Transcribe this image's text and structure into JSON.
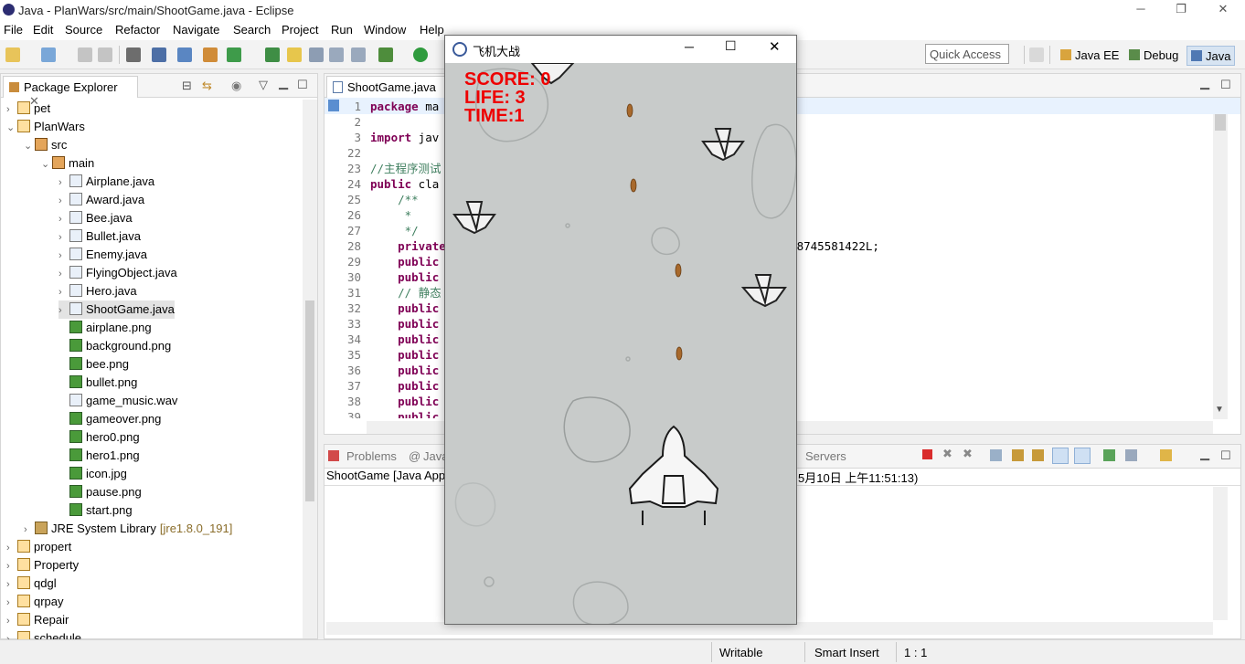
{
  "window": {
    "title": "Java - PlanWars/src/main/ShootGame.java - Eclipse"
  },
  "menu": [
    "File",
    "Edit",
    "Source",
    "Refactor",
    "Navigate",
    "Search",
    "Project",
    "Run",
    "Window",
    "Help"
  ],
  "toolbar": {
    "quick_access_placeholder": "Quick Access"
  },
  "perspectives": [
    "Java EE",
    "Debug",
    "Java"
  ],
  "package_explorer": {
    "title": "Package Explorer",
    "tree": [
      {
        "label": "pet",
        "indent": 0,
        "arrow": ">",
        "icon": "project"
      },
      {
        "label": "PlanWars",
        "indent": 0,
        "arrow": "v",
        "icon": "project"
      },
      {
        "label": "src",
        "indent": 1,
        "arrow": "v",
        "icon": "src-folder"
      },
      {
        "label": "main",
        "indent": 2,
        "arrow": "v",
        "icon": "package"
      },
      {
        "label": "Airplane.java",
        "indent": 3,
        "arrow": ">",
        "icon": "java-file"
      },
      {
        "label": "Award.java",
        "indent": 3,
        "arrow": ">",
        "icon": "java-file"
      },
      {
        "label": "Bee.java",
        "indent": 3,
        "arrow": ">",
        "icon": "java-file"
      },
      {
        "label": "Bullet.java",
        "indent": 3,
        "arrow": ">",
        "icon": "java-file"
      },
      {
        "label": "Enemy.java",
        "indent": 3,
        "arrow": ">",
        "icon": "java-file"
      },
      {
        "label": "FlyingObject.java",
        "indent": 3,
        "arrow": ">",
        "icon": "java-file"
      },
      {
        "label": "Hero.java",
        "indent": 3,
        "arrow": ">",
        "icon": "java-file"
      },
      {
        "label": "ShootGame.java",
        "indent": 3,
        "arrow": ">",
        "icon": "java-file",
        "selected": true
      },
      {
        "label": "airplane.png",
        "indent": 3,
        "arrow": "",
        "icon": "image-file"
      },
      {
        "label": "background.png",
        "indent": 3,
        "arrow": "",
        "icon": "image-file"
      },
      {
        "label": "bee.png",
        "indent": 3,
        "arrow": "",
        "icon": "image-file"
      },
      {
        "label": "bullet.png",
        "indent": 3,
        "arrow": "",
        "icon": "image-file"
      },
      {
        "label": "game_music.wav",
        "indent": 3,
        "arrow": "",
        "icon": "file"
      },
      {
        "label": "gameover.png",
        "indent": 3,
        "arrow": "",
        "icon": "image-file"
      },
      {
        "label": "hero0.png",
        "indent": 3,
        "arrow": "",
        "icon": "image-file"
      },
      {
        "label": "hero1.png",
        "indent": 3,
        "arrow": "",
        "icon": "image-file"
      },
      {
        "label": "icon.jpg",
        "indent": 3,
        "arrow": "",
        "icon": "image-file"
      },
      {
        "label": "pause.png",
        "indent": 3,
        "arrow": "",
        "icon": "image-file"
      },
      {
        "label": "start.png",
        "indent": 3,
        "arrow": "",
        "icon": "image-file"
      },
      {
        "label": "JRE System Library",
        "suffix": "[jre1.8.0_191]",
        "indent": 1,
        "arrow": ">",
        "icon": "library"
      },
      {
        "label": "propert",
        "indent": 0,
        "arrow": ">",
        "icon": "project"
      },
      {
        "label": "Property",
        "indent": 0,
        "arrow": ">",
        "icon": "project"
      },
      {
        "label": "qdgl",
        "indent": 0,
        "arrow": ">",
        "icon": "project"
      },
      {
        "label": "qrpay",
        "indent": 0,
        "arrow": ">",
        "icon": "project"
      },
      {
        "label": "Repair",
        "indent": 0,
        "arrow": ">",
        "icon": "project"
      },
      {
        "label": "schedule",
        "indent": 0,
        "arrow": ">",
        "icon": "project"
      }
    ]
  },
  "editor": {
    "tab": "ShootGame.java",
    "lines": [
      {
        "n": "1",
        "kw": "package",
        "rest": " ma"
      },
      {
        "n": "2",
        "kw": "",
        "rest": ""
      },
      {
        "n": "3",
        "kw": "import",
        "rest": " jav"
      },
      {
        "n": "22",
        "kw": "",
        "rest": ""
      },
      {
        "n": "23",
        "kw": "",
        "rest": "",
        "comment": "//主程序测试"
      },
      {
        "n": "24",
        "kw": "public",
        "rest": " cla"
      },
      {
        "n": "25",
        "kw": "",
        "rest": "",
        "comment": "    /**"
      },
      {
        "n": "26",
        "kw": "",
        "rest": "",
        "comment": "     *"
      },
      {
        "n": "27",
        "kw": "",
        "rest": "",
        "comment": "     */"
      },
      {
        "n": "28",
        "kw": "    private",
        "rest": "                                                   8745581422L;"
      },
      {
        "n": "29",
        "kw": "    public",
        "rest": ""
      },
      {
        "n": "30",
        "kw": "    public",
        "rest": ""
      },
      {
        "n": "31",
        "kw": "",
        "rest": "",
        "comment": "    // 静态"
      },
      {
        "n": "32",
        "kw": "    public",
        "rest": ""
      },
      {
        "n": "33",
        "kw": "    public",
        "rest": ""
      },
      {
        "n": "34",
        "kw": "    public",
        "rest": ""
      },
      {
        "n": "35",
        "kw": "    public",
        "rest": ""
      },
      {
        "n": "36",
        "kw": "    public",
        "rest": ""
      },
      {
        "n": "37",
        "kw": "    public",
        "rest": ""
      },
      {
        "n": "38",
        "kw": "    public",
        "rest": ""
      },
      {
        "n": "39",
        "kw": "    public",
        "rest": ""
      }
    ]
  },
  "console": {
    "tabs": [
      "Problems",
      "Java",
      "Servers"
    ],
    "run_label": "ShootGame [Java App",
    "run_time": "5月10日 上午11:51:13)"
  },
  "status": {
    "writable": "Writable",
    "insert": "Smart Insert",
    "position": "1 : 1"
  },
  "game": {
    "title": "飞机大战",
    "score": "SCORE: 0",
    "life": "LIFE: 3",
    "time": "TIME:1"
  }
}
